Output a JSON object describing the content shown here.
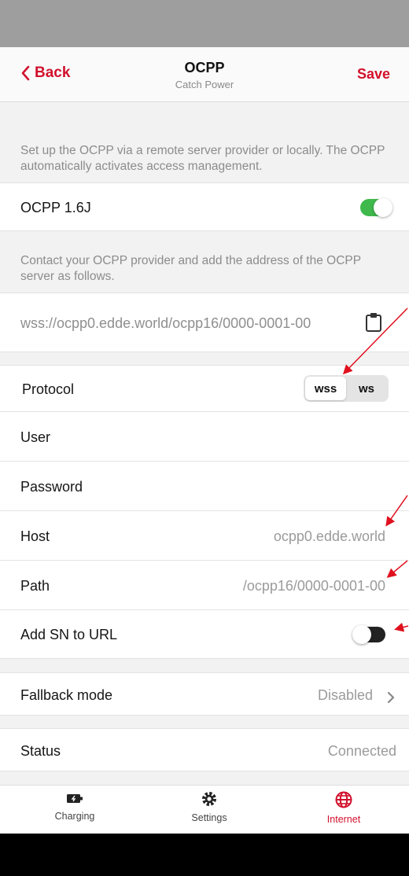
{
  "nav": {
    "back_label": "Back",
    "title": "OCPP",
    "subtitle": "Catch Power",
    "save_label": "Save"
  },
  "intro_text": "Set up the OCPP via a remote server provider or locally. The OCPP automatically activates access management.",
  "ocpp_toggle": {
    "label": "OCPP 1.6J",
    "enabled": true
  },
  "contact_text": "Contact your OCPP provider and add the address of the OCPP server as follows.",
  "server_url": "wss://ocpp0.edde.world/ocpp16/0000-0001-00",
  "protocol": {
    "label": "Protocol",
    "options": [
      "wss",
      "ws"
    ],
    "selected": "wss"
  },
  "user": {
    "label": "User",
    "value": ""
  },
  "password": {
    "label": "Password",
    "value": ""
  },
  "host": {
    "label": "Host",
    "value": "ocpp0.edde.world"
  },
  "path": {
    "label": "Path",
    "value": "/ocpp16/0000-0001-00"
  },
  "add_sn": {
    "label": "Add SN to URL",
    "enabled": false
  },
  "fallback": {
    "label": "Fallback mode",
    "value": "Disabled"
  },
  "status": {
    "label": "Status",
    "value": "Connected"
  },
  "tabs": [
    {
      "label": "Charging",
      "icon": "battery-icon"
    },
    {
      "label": "Settings",
      "icon": "gear-icon"
    },
    {
      "label": "Internet",
      "icon": "globe-icon",
      "active": true
    }
  ],
  "colors": {
    "accent": "#d2102c",
    "toggle_on": "#3fb84c",
    "annotation_arrow": "#e0101e"
  }
}
